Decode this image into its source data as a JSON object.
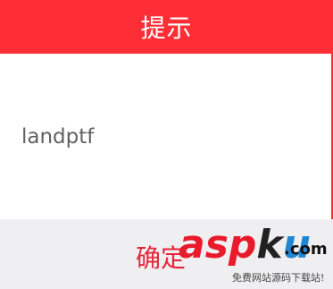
{
  "dialog": {
    "title": "提示",
    "message": "landptf",
    "confirm_label": "确定"
  },
  "watermark": {
    "a": "a",
    "s": "s",
    "p": "p",
    "k": "k",
    "u": "u",
    "domain": ".com",
    "subtitle": "免费网站源码下载站!"
  },
  "colors": {
    "header": "#fd2e36",
    "footer": "#efeff1",
    "confirm_text": "#e8233a",
    "message_text": "#616161"
  }
}
